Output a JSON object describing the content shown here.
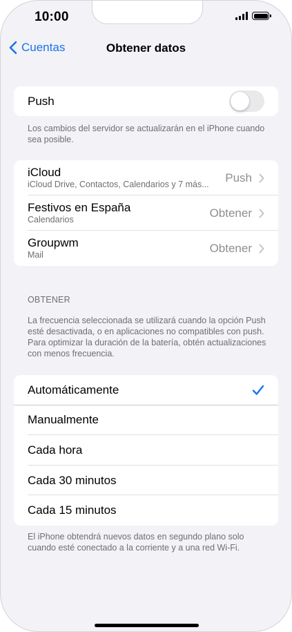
{
  "status_bar": {
    "time": "10:00"
  },
  "nav": {
    "back_label": "Cuentas",
    "title": "Obtener datos"
  },
  "push_section": {
    "label": "Push",
    "enabled": false,
    "footer": "Los cambios del servidor se actualizarán en el iPhone cuando sea posible."
  },
  "accounts": [
    {
      "name": "iCloud",
      "detail": "iCloud Drive, Contactos, Calendarios y 7 más...",
      "mode": "Push"
    },
    {
      "name": "Festivos en España",
      "detail": "Calendarios",
      "mode": "Obtener"
    },
    {
      "name": "Groupwm",
      "detail": "Mail",
      "mode": "Obtener"
    }
  ],
  "fetch_section": {
    "header": "OBTENER",
    "description": "La frecuencia seleccionada se utilizará cuando la opción Push esté desactivada, o en aplicaciones no compatibles con push. Para optimizar la duración de la batería, obtén actualizaciones con menos frecuencia.",
    "options": [
      {
        "label": "Automáticamente",
        "selected": true
      },
      {
        "label": "Manualmente",
        "selected": false
      },
      {
        "label": "Cada hora",
        "selected": false
      },
      {
        "label": "Cada 30 minutos",
        "selected": false
      },
      {
        "label": "Cada 15 minutos",
        "selected": false
      }
    ],
    "footer": "El iPhone obtendrá nuevos datos en segundo plano solo cuando esté conectado a la corriente y a una red Wi-Fi."
  },
  "colors": {
    "accent": "#1a73e8",
    "background": "#f2f2f7",
    "secondary_text": "#6e6e73"
  }
}
